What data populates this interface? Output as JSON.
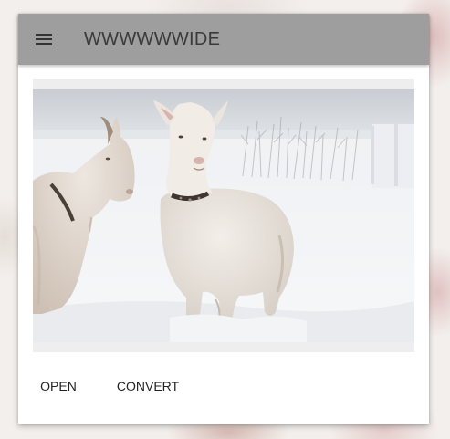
{
  "toolbar": {
    "title": "WWWWWWIDE",
    "menu_icon": "menu-icon",
    "background_color": "#9e9e9e"
  },
  "image": {
    "description_icon": "goats-in-snow-photo"
  },
  "actions": {
    "open_label": "OPEN",
    "convert_label": "CONVERT"
  }
}
